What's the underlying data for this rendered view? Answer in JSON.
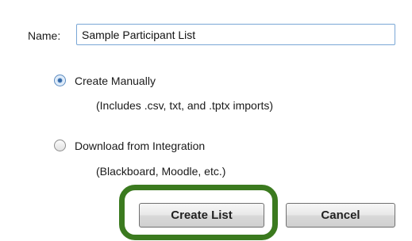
{
  "form": {
    "name_label": "Name:",
    "name_value": "Sample Participant List",
    "options": [
      {
        "label": "Create Manually",
        "note": "(Includes .csv, txt, and .tptx imports)",
        "selected": true
      },
      {
        "label": "Download from Integration",
        "note": "(Blackboard, Moodle, etc.)",
        "selected": false
      }
    ]
  },
  "buttons": {
    "create_label": "Create List",
    "cancel_label": "Cancel"
  },
  "colors": {
    "highlight_ring": "#3b7a1f",
    "input_border": "#7aa7d6",
    "radio_selected": "#3f76b5"
  }
}
